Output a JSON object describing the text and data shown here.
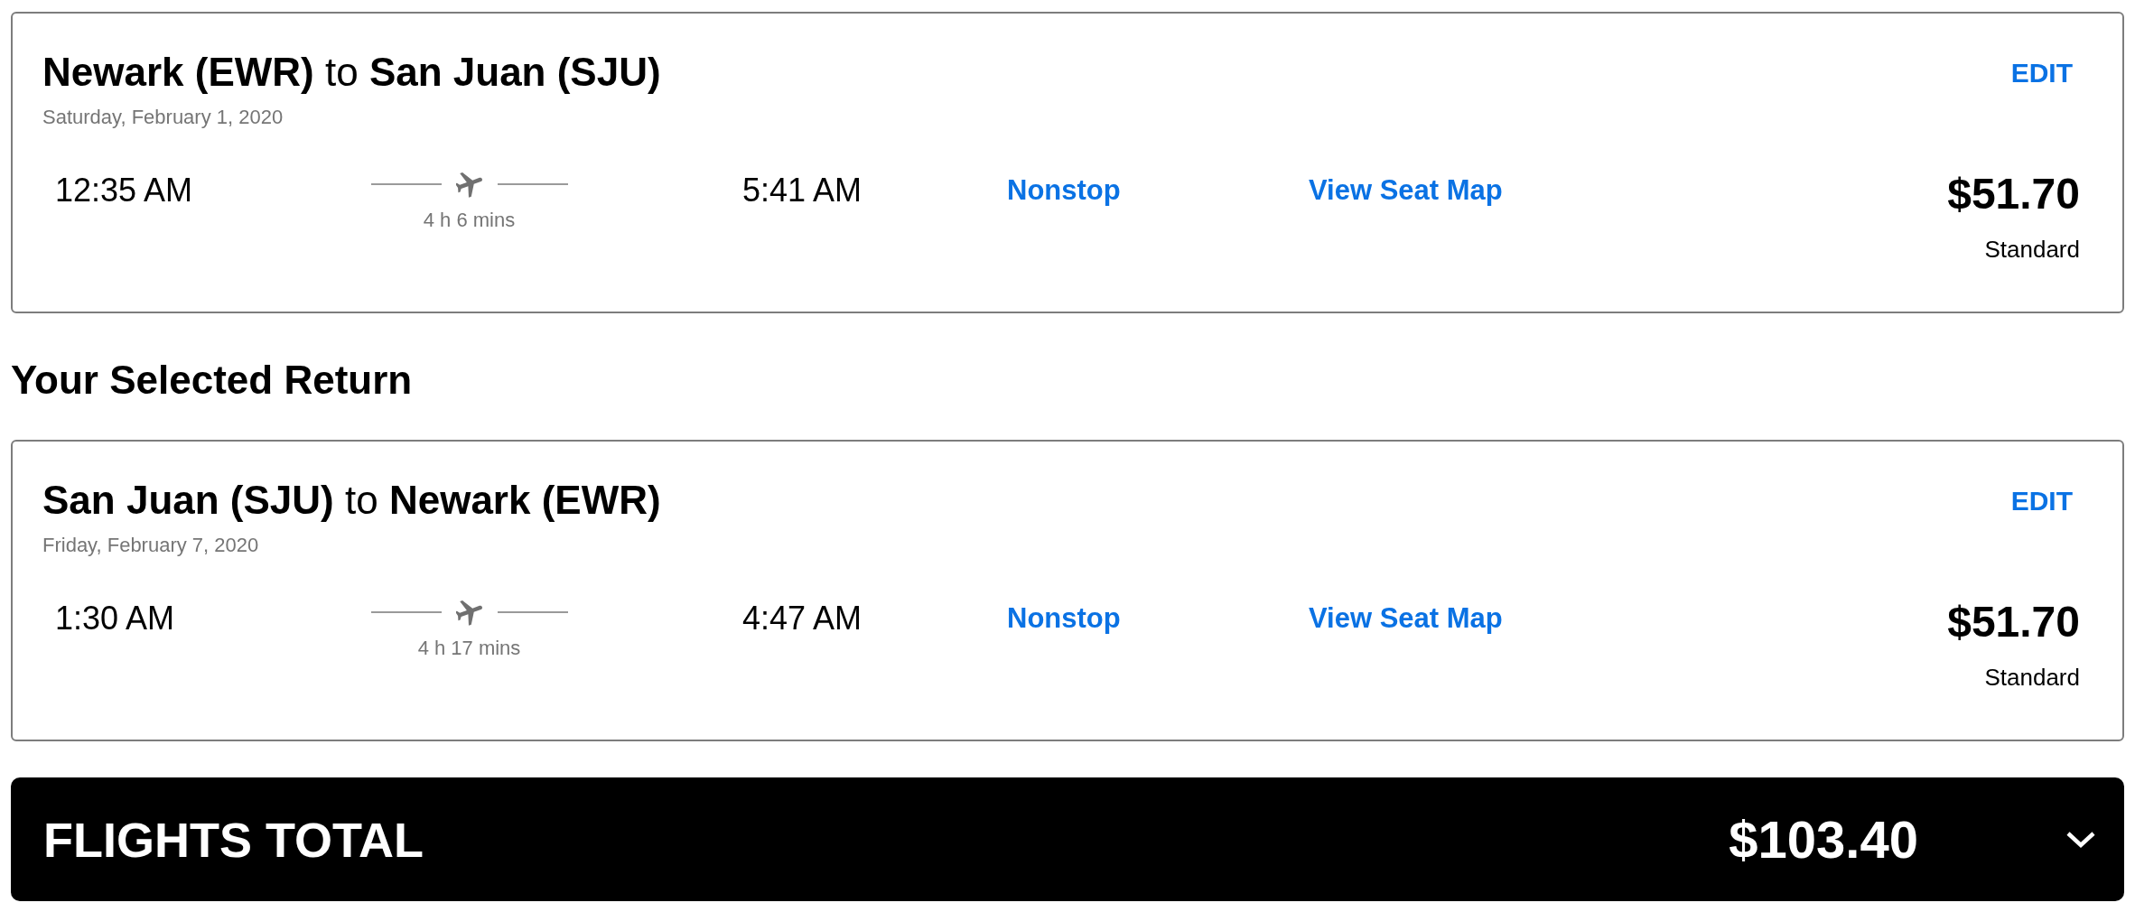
{
  "sections": [
    {
      "flight": {
        "route": "**Newark (EWR)** to **San Juan (SJU)**",
        "date": "Saturday, February 1, 2020",
        "edit": "EDIT",
        "depart": "12:35 AM",
        "duration": "4 h 6 mins",
        "arrive": "5:41 AM",
        "stops": "Nonstop",
        "seat_map": "View Seat Map",
        "price": "$51.70",
        "fare": "Standard"
      }
    },
    {
      "heading": "Your Selected Return",
      "flight": {
        "route": "**San Juan (SJU)** to **Newark (EWR)**",
        "date": "Friday, February 7, 2020",
        "edit": "EDIT",
        "depart": "1:30 AM",
        "duration": "4 h 17 mins",
        "arrive": "4:47 AM",
        "stops": "Nonstop",
        "seat_map": "View Seat Map",
        "price": "$51.70",
        "fare": "Standard"
      }
    }
  ],
  "total": {
    "label": "FLIGHTS TOTAL",
    "amount": "$103.40",
    "expanded": false
  }
}
